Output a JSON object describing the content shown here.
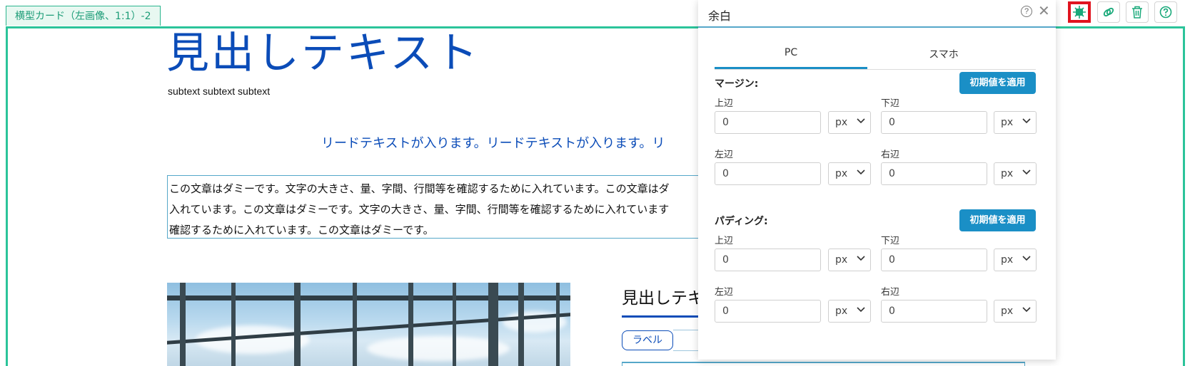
{
  "block": {
    "tag_label": "横型カード（左画像、1:1）-2"
  },
  "toolbar": [
    {
      "name": "spacing-icon"
    },
    {
      "name": "link-icon"
    },
    {
      "name": "trash-icon"
    },
    {
      "name": "help-icon"
    }
  ],
  "content": {
    "heading": "見出しテキスト",
    "subtext": "subtext subtext subtext",
    "lead": "リードテキストが入ります。リードテキストが入ります。リ",
    "body_lines": [
      "この文章はダミーです。文字の大きさ、量、字間、行間等を確認するために入れています。この文章はダ",
      "入れています。この文章はダミーです。文字の大きさ、量、字間、行間等を確認するために入れています",
      "確認するために入れています。この文章はダミーです。"
    ],
    "card_heading": "見出しテキ",
    "label": "ラベル"
  },
  "panel": {
    "title": "余白",
    "help_glyph": "?",
    "close_glyph": "✕",
    "tabs": [
      "PC",
      "スマホ"
    ],
    "active_tab": "PC",
    "margin": {
      "label": "マージン:",
      "apply_label": "初期値を適用",
      "top_label": "上辺",
      "top_value": "0",
      "top_unit": "px",
      "bottom_label": "下辺",
      "bottom_value": "0",
      "bottom_unit": "px",
      "left_label": "左辺",
      "left_value": "0",
      "left_unit": "px",
      "right_label": "右辺",
      "right_value": "0",
      "right_unit": "px"
    },
    "padding": {
      "label": "パディング:",
      "apply_label": "初期値を適用",
      "top_label": "上辺",
      "top_value": "0",
      "top_unit": "px",
      "bottom_label": "下辺",
      "bottom_value": "0",
      "bottom_unit": "px",
      "left_label": "左辺",
      "left_value": "0",
      "left_unit": "px",
      "right_label": "右辺",
      "right_value": "0",
      "right_unit": "px"
    }
  },
  "colors": {
    "accent": "#1a8fc6",
    "heading_blue": "#0b4cb8",
    "frame_green": "#2bc49a",
    "active_red": "#e0141f"
  }
}
